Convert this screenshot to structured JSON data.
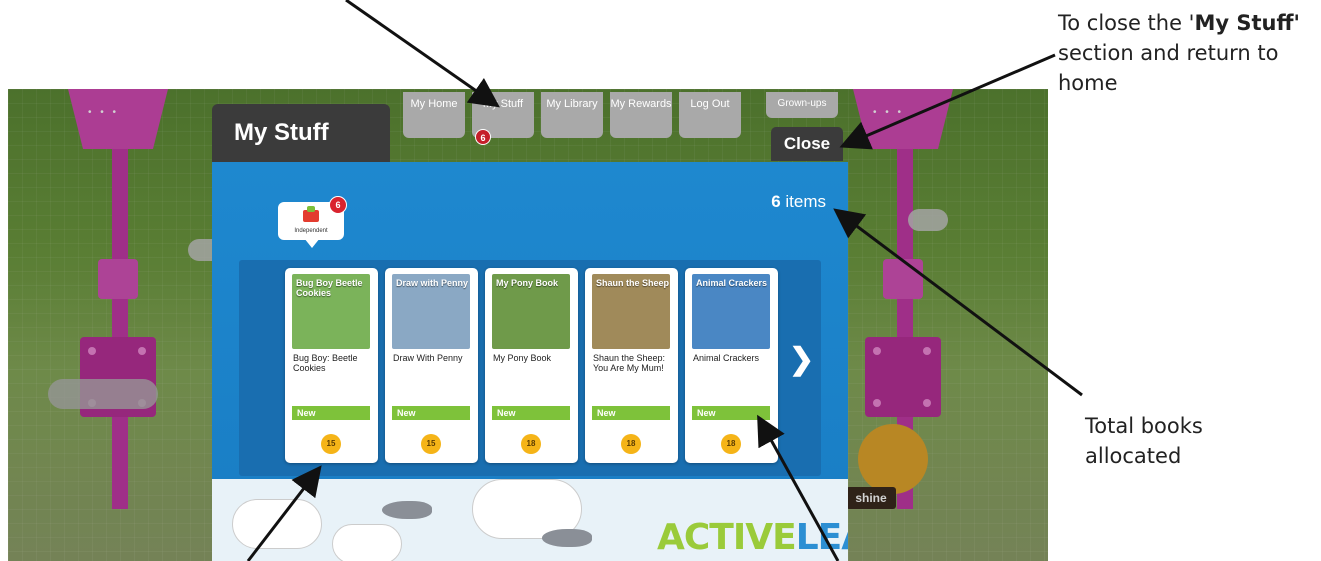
{
  "nav": {
    "items": [
      {
        "label": "My Home"
      },
      {
        "label": "My Stuff",
        "badge": "6"
      },
      {
        "label": "My Library"
      },
      {
        "label": "My Rewards"
      },
      {
        "label": "Log Out"
      }
    ],
    "grownups": "Grown-ups"
  },
  "panel": {
    "title": "My Stuff",
    "close": "Close",
    "items_count": "6",
    "items_suffix": " items",
    "shelf_tab": {
      "label": "Independent",
      "badge": "6"
    },
    "books": [
      {
        "title": "Bug Boy: Beetle Cookies",
        "tag": "New",
        "level": "15",
        "cover_color": "#7bb35a",
        "cover_text": "Bug Boy Beetle Cookies"
      },
      {
        "title": "Draw With Penny",
        "tag": "New",
        "level": "15",
        "cover_color": "#8aa8c4",
        "cover_text": "Draw with Penny"
      },
      {
        "title": "My Pony Book",
        "tag": "New",
        "level": "18",
        "cover_color": "#6f9a4a",
        "cover_text": "My Pony Book"
      },
      {
        "title": "Shaun the Sheep: You Are My Mum!",
        "tag": "New",
        "level": "18",
        "cover_color": "#a08a5a",
        "cover_text": "Shaun the Sheep"
      },
      {
        "title": "Animal Crackers",
        "tag": "New",
        "level": "18",
        "cover_color": "#4a87c4",
        "cover_text": "Animal Crackers"
      }
    ],
    "logo_a": "ACTIVE",
    "logo_b": "LEARN"
  },
  "side": {
    "shine": "shine"
  },
  "annotations": {
    "close_a": "To close the '",
    "close_b": "My Stuff'",
    "close_c": " section and return to home",
    "total": "Total books allocated"
  }
}
